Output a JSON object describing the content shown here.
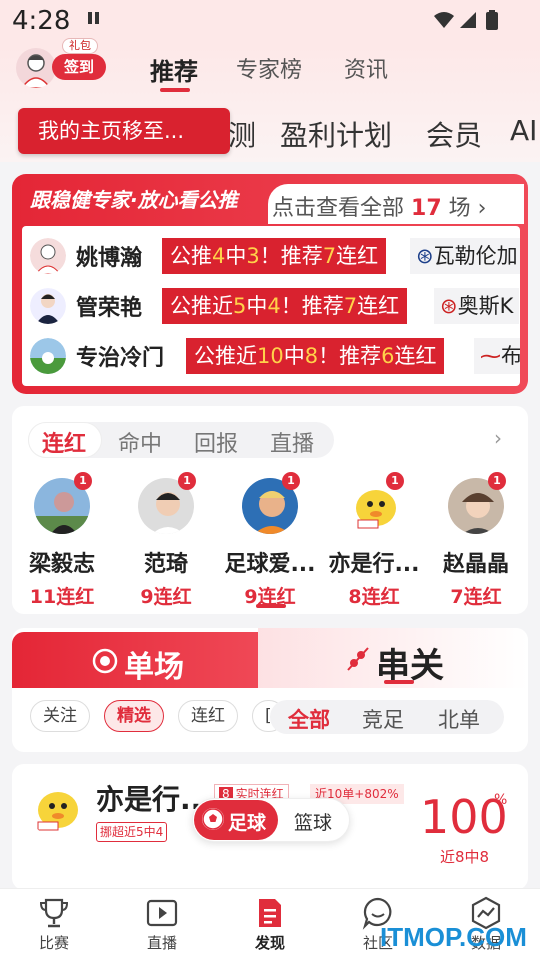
{
  "status_bar": {
    "time": "4:28"
  },
  "header": {
    "gift_tag": "礼包",
    "signin_label": "签到",
    "tabs": [
      {
        "label": "推荐",
        "active": true
      },
      {
        "label": "专家榜",
        "active": false
      },
      {
        "label": "资讯",
        "active": false
      }
    ],
    "subtabs": [
      "测",
      "盈利计划",
      "会员",
      "AI"
    ],
    "tooltip": "我的主页移至..."
  },
  "banner": {
    "slogan": "跟稳健专家·放心看公推",
    "view_all_prefix": "点击查看全部",
    "view_all_count": "17",
    "view_all_suffix": "场 ›",
    "rows": [
      {
        "name": "姚博瀚",
        "tag_parts": [
          "公推",
          "4",
          "中",
          "3",
          "！推荐",
          "7",
          "连红"
        ],
        "team": "瓦勒伦加"
      },
      {
        "name": "管荣艳",
        "tag_parts": [
          "公推近",
          "5",
          "中",
          "4",
          "！推荐",
          "7",
          "连红"
        ],
        "team": "奥斯K"
      },
      {
        "name": "专治冷门",
        "tag_parts": [
          "公推近",
          "10",
          "中",
          "8",
          "！推荐",
          "6",
          "连红"
        ],
        "team": "布"
      }
    ]
  },
  "streak": {
    "tabs": [
      {
        "label": "连红",
        "active": true
      },
      {
        "label": "命中",
        "active": false
      },
      {
        "label": "回报",
        "active": false
      },
      {
        "label": "直播",
        "active": false
      }
    ],
    "experts": [
      {
        "name": "梁毅志",
        "streak": "11连红",
        "badge": "1"
      },
      {
        "name": "范琦",
        "streak": "9连红",
        "badge": "1"
      },
      {
        "name": "足球爱...",
        "streak": "9连红",
        "badge": "1"
      },
      {
        "name": "亦是行...",
        "streak": "8连红",
        "badge": "1"
      },
      {
        "name": "赵晶晶",
        "streak": "7连红",
        "badge": "1"
      }
    ]
  },
  "mode": {
    "single_label": "单场",
    "parlay_label": "串关",
    "chips": [
      {
        "label": "关注",
        "active": false
      },
      {
        "label": "精选",
        "active": true
      },
      {
        "label": "连红",
        "active": false
      },
      {
        "label": "[",
        "active": false
      }
    ],
    "filters": [
      {
        "label": "全部",
        "active": true
      },
      {
        "label": "竞足",
        "active": false
      },
      {
        "label": "北单",
        "active": false
      }
    ]
  },
  "recommendation": {
    "name": "亦是行..",
    "tag1_num": "8",
    "tag1_text": "实时连红",
    "tag2": "近10单+802%",
    "tag3": "挪超近5中4",
    "rate": "100",
    "rate_unit": "%",
    "sub": "近8中8"
  },
  "sport_toggle": {
    "football": "足球",
    "basketball": "篮球"
  },
  "bottom_nav": [
    {
      "label": "比赛",
      "icon": "trophy-icon",
      "active": false
    },
    {
      "label": "直播",
      "icon": "play-icon",
      "active": false
    },
    {
      "label": "发现",
      "icon": "discover-icon",
      "active": true
    },
    {
      "label": "社区",
      "icon": "chat-icon",
      "active": false
    },
    {
      "label": "数据",
      "icon": "chart-icon",
      "active": false
    }
  ],
  "watermark": "ITMOP.COM",
  "colors": {
    "accent": "#e02d3c",
    "highlight": "#ffd24a"
  }
}
